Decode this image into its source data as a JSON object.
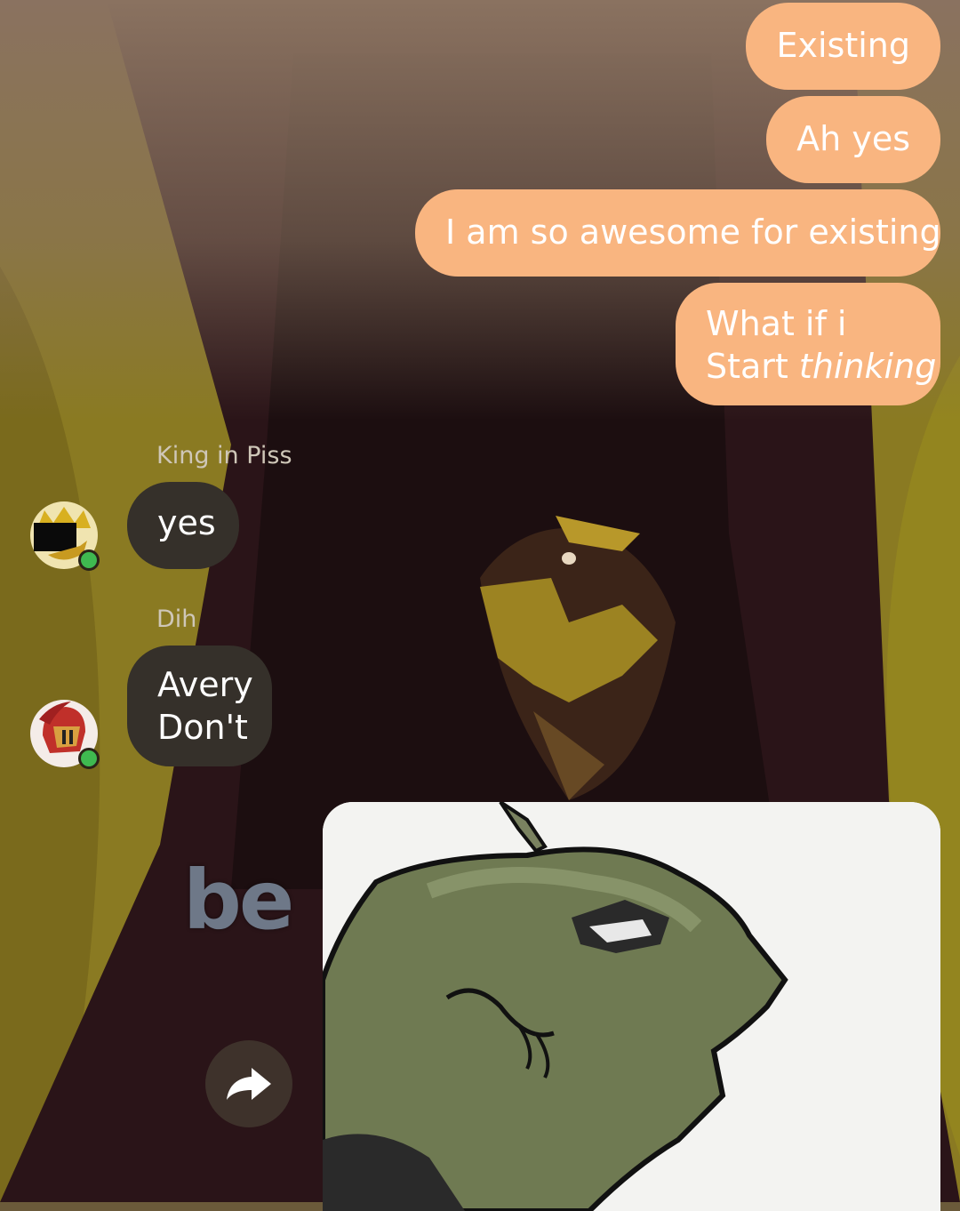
{
  "messages_out": [
    {
      "lines": [
        "Existing"
      ]
    },
    {
      "lines": [
        "Ah yes"
      ]
    },
    {
      "lines": [
        "I am so awesome for existing"
      ]
    },
    {
      "lines": [
        "What if i",
        "Start "
      ],
      "emphasis": "thinking"
    }
  ],
  "messages_in": [
    {
      "sender": "King in Piss",
      "lines": [
        "yes"
      ],
      "avatar": "gold-crown-avatar",
      "online": true
    },
    {
      "sender": "Dih",
      "lines": [
        "Avery",
        "Don't"
      ],
      "avatar": "red-helmet-avatar",
      "online": true
    }
  ],
  "overlay": {
    "text": "be"
  },
  "icons": {
    "forward": "forward-arrow-icon"
  },
  "colors": {
    "outgoing_bubble": "#f9b580",
    "incoming_bubble": "#35302a",
    "online_dot": "#3fb950"
  }
}
